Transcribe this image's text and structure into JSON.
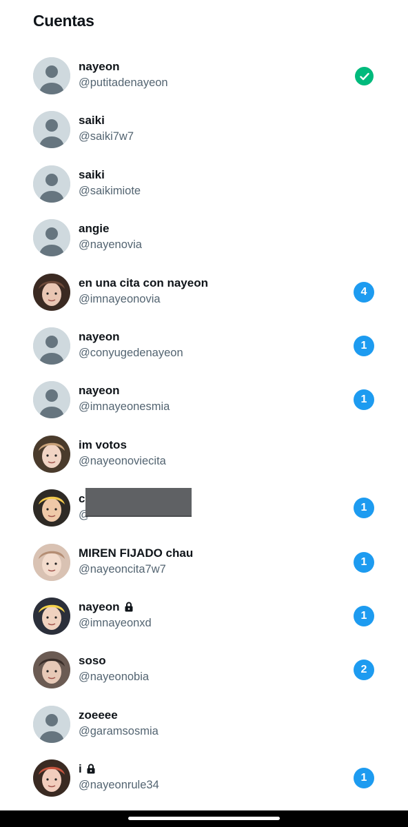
{
  "header": {
    "title": "Cuentas"
  },
  "colors": {
    "accent": "#1d9bf0",
    "check": "#00ba7c",
    "handle": "#536471",
    "placeholder_bg": "#cfd9de"
  },
  "accounts": [
    {
      "name": "nayeon",
      "handle": "@putitadenayeon",
      "badge": "",
      "active": true,
      "locked": false,
      "avatar": "default"
    },
    {
      "name": "saiki",
      "handle": "@saiki7w7",
      "badge": "",
      "active": false,
      "locked": false,
      "avatar": "default"
    },
    {
      "name": "saiki",
      "handle": "@saikimiote",
      "badge": "",
      "active": false,
      "locked": false,
      "avatar": "default"
    },
    {
      "name": "angie",
      "handle": "@nayenovia",
      "badge": "",
      "active": false,
      "locked": false,
      "avatar": "default"
    },
    {
      "name": "en una cita con nayeon",
      "handle": "@imnayeonovia",
      "badge": "4",
      "active": false,
      "locked": false,
      "avatar": "photo"
    },
    {
      "name": "nayeon",
      "handle": "@conyugedenayeon",
      "badge": "1",
      "active": false,
      "locked": false,
      "avatar": "default"
    },
    {
      "name": "nayeon",
      "handle": "@imnayeonesmia",
      "badge": "1",
      "active": false,
      "locked": false,
      "avatar": "default"
    },
    {
      "name": "im votos",
      "handle": "@nayeonoviecita",
      "badge": "",
      "active": false,
      "locked": false,
      "avatar": "photo"
    },
    {
      "name": "c",
      "handle": "@",
      "badge": "1",
      "active": false,
      "locked": false,
      "avatar": "photo",
      "redacted": true
    },
    {
      "name": "MIREN FIJADO chau",
      "handle": "@nayeoncita7w7",
      "badge": "1",
      "active": false,
      "locked": false,
      "avatar": "photo"
    },
    {
      "name": "nayeon",
      "handle": "@imnayeonxd",
      "badge": "1",
      "active": false,
      "locked": true,
      "avatar": "photo"
    },
    {
      "name": "soso",
      "handle": "@nayeonobia",
      "badge": "2",
      "active": false,
      "locked": false,
      "avatar": "photo"
    },
    {
      "name": "zoeeee",
      "handle": "@garamsosmia",
      "badge": "",
      "active": false,
      "locked": false,
      "avatar": "default"
    },
    {
      "name": "i",
      "handle": "@nayeonrule34",
      "badge": "1",
      "active": false,
      "locked": true,
      "avatar": "photo"
    }
  ]
}
